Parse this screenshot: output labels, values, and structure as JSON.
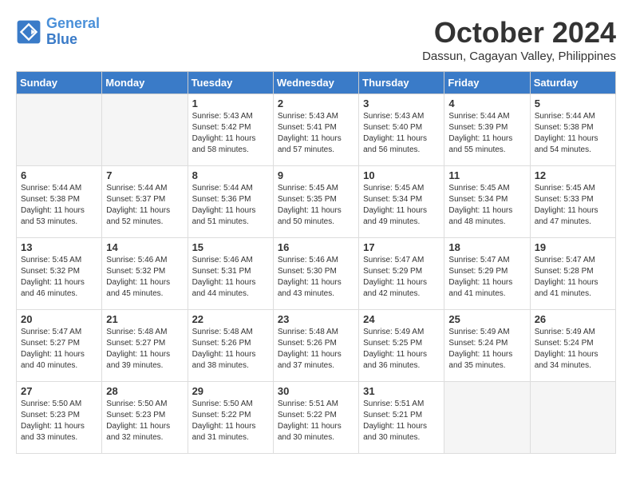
{
  "logo": {
    "line1": "General",
    "line2": "Blue"
  },
  "title": "October 2024",
  "location": "Dassun, Cagayan Valley, Philippines",
  "weekdays": [
    "Sunday",
    "Monday",
    "Tuesday",
    "Wednesday",
    "Thursday",
    "Friday",
    "Saturday"
  ],
  "weeks": [
    [
      {
        "day": "",
        "empty": true
      },
      {
        "day": "",
        "empty": true
      },
      {
        "day": "1",
        "sunrise": "5:43 AM",
        "sunset": "5:42 PM",
        "daylight": "11 hours and 58 minutes."
      },
      {
        "day": "2",
        "sunrise": "5:43 AM",
        "sunset": "5:41 PM",
        "daylight": "11 hours and 57 minutes."
      },
      {
        "day": "3",
        "sunrise": "5:43 AM",
        "sunset": "5:40 PM",
        "daylight": "11 hours and 56 minutes."
      },
      {
        "day": "4",
        "sunrise": "5:44 AM",
        "sunset": "5:39 PM",
        "daylight": "11 hours and 55 minutes."
      },
      {
        "day": "5",
        "sunrise": "5:44 AM",
        "sunset": "5:38 PM",
        "daylight": "11 hours and 54 minutes."
      }
    ],
    [
      {
        "day": "6",
        "sunrise": "5:44 AM",
        "sunset": "5:38 PM",
        "daylight": "11 hours and 53 minutes."
      },
      {
        "day": "7",
        "sunrise": "5:44 AM",
        "sunset": "5:37 PM",
        "daylight": "11 hours and 52 minutes."
      },
      {
        "day": "8",
        "sunrise": "5:44 AM",
        "sunset": "5:36 PM",
        "daylight": "11 hours and 51 minutes."
      },
      {
        "day": "9",
        "sunrise": "5:45 AM",
        "sunset": "5:35 PM",
        "daylight": "11 hours and 50 minutes."
      },
      {
        "day": "10",
        "sunrise": "5:45 AM",
        "sunset": "5:34 PM",
        "daylight": "11 hours and 49 minutes."
      },
      {
        "day": "11",
        "sunrise": "5:45 AM",
        "sunset": "5:34 PM",
        "daylight": "11 hours and 48 minutes."
      },
      {
        "day": "12",
        "sunrise": "5:45 AM",
        "sunset": "5:33 PM",
        "daylight": "11 hours and 47 minutes."
      }
    ],
    [
      {
        "day": "13",
        "sunrise": "5:45 AM",
        "sunset": "5:32 PM",
        "daylight": "11 hours and 46 minutes."
      },
      {
        "day": "14",
        "sunrise": "5:46 AM",
        "sunset": "5:32 PM",
        "daylight": "11 hours and 45 minutes."
      },
      {
        "day": "15",
        "sunrise": "5:46 AM",
        "sunset": "5:31 PM",
        "daylight": "11 hours and 44 minutes."
      },
      {
        "day": "16",
        "sunrise": "5:46 AM",
        "sunset": "5:30 PM",
        "daylight": "11 hours and 43 minutes."
      },
      {
        "day": "17",
        "sunrise": "5:47 AM",
        "sunset": "5:29 PM",
        "daylight": "11 hours and 42 minutes."
      },
      {
        "day": "18",
        "sunrise": "5:47 AM",
        "sunset": "5:29 PM",
        "daylight": "11 hours and 41 minutes."
      },
      {
        "day": "19",
        "sunrise": "5:47 AM",
        "sunset": "5:28 PM",
        "daylight": "11 hours and 41 minutes."
      }
    ],
    [
      {
        "day": "20",
        "sunrise": "5:47 AM",
        "sunset": "5:27 PM",
        "daylight": "11 hours and 40 minutes."
      },
      {
        "day": "21",
        "sunrise": "5:48 AM",
        "sunset": "5:27 PM",
        "daylight": "11 hours and 39 minutes."
      },
      {
        "day": "22",
        "sunrise": "5:48 AM",
        "sunset": "5:26 PM",
        "daylight": "11 hours and 38 minutes."
      },
      {
        "day": "23",
        "sunrise": "5:48 AM",
        "sunset": "5:26 PM",
        "daylight": "11 hours and 37 minutes."
      },
      {
        "day": "24",
        "sunrise": "5:49 AM",
        "sunset": "5:25 PM",
        "daylight": "11 hours and 36 minutes."
      },
      {
        "day": "25",
        "sunrise": "5:49 AM",
        "sunset": "5:24 PM",
        "daylight": "11 hours and 35 minutes."
      },
      {
        "day": "26",
        "sunrise": "5:49 AM",
        "sunset": "5:24 PM",
        "daylight": "11 hours and 34 minutes."
      }
    ],
    [
      {
        "day": "27",
        "sunrise": "5:50 AM",
        "sunset": "5:23 PM",
        "daylight": "11 hours and 33 minutes."
      },
      {
        "day": "28",
        "sunrise": "5:50 AM",
        "sunset": "5:23 PM",
        "daylight": "11 hours and 32 minutes."
      },
      {
        "day": "29",
        "sunrise": "5:50 AM",
        "sunset": "5:22 PM",
        "daylight": "11 hours and 31 minutes."
      },
      {
        "day": "30",
        "sunrise": "5:51 AM",
        "sunset": "5:22 PM",
        "daylight": "11 hours and 30 minutes."
      },
      {
        "day": "31",
        "sunrise": "5:51 AM",
        "sunset": "5:21 PM",
        "daylight": "11 hours and 30 minutes."
      },
      {
        "day": "",
        "empty": true
      },
      {
        "day": "",
        "empty": true
      }
    ]
  ]
}
